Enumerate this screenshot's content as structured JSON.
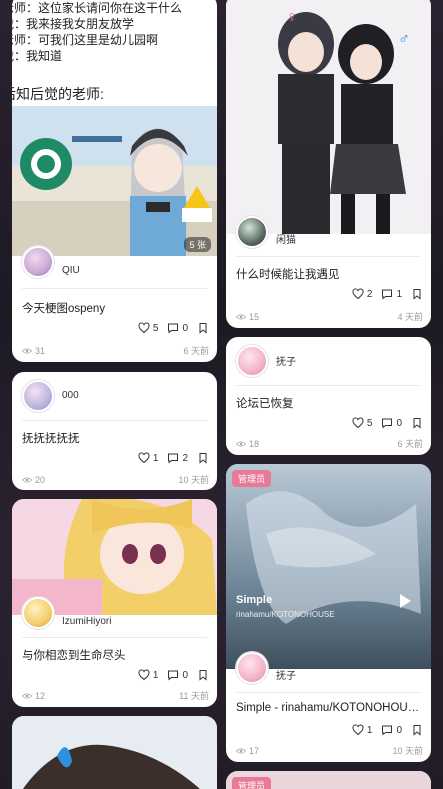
{
  "left_column": {
    "text_post": {
      "lines": [
        "老师：这位家长请问你在这干什么",
        "我：我来接我女朋友放学",
        "老师：可我们这里是幼儿园啊",
        "我：我知道"
      ],
      "heading": "后知后觉的老师:"
    },
    "cards": [
      {
        "author": "QIU",
        "image_count": "5 张",
        "title": "今天梗图ospeny",
        "likes": "5",
        "comments": "0",
        "views": "31",
        "time": "6 天前"
      },
      {
        "author": "000",
        "title": "抚抚抚抚抚",
        "likes": "1",
        "comments": "2",
        "views": "20",
        "time": "10 天前"
      },
      {
        "author": "IzumiHiyori",
        "title": "与你相恋到生命尽头",
        "likes": "1",
        "comments": "0",
        "views": "12",
        "time": "11 天前"
      }
    ]
  },
  "right_column": {
    "cards": [
      {
        "author": "闲猫",
        "title": "什么时候能让我遇见",
        "likes": "2",
        "comments": "1",
        "views": "15",
        "time": "4 天前"
      },
      {
        "author": "抚子",
        "title": "论坛已恢复",
        "likes": "5",
        "comments": "0",
        "views": "18",
        "time": "6 天前"
      },
      {
        "tag": "管理员",
        "music_title": "Simple",
        "music_artist": "rinahamu/KOTONOHOUSE",
        "author": "抚子",
        "title": "Simple - rinahamu/KOTONOHOUSE",
        "likes": "1",
        "comments": "0",
        "views": "17",
        "time": "10 天前"
      },
      {
        "tag": "管理员"
      }
    ]
  },
  "colors": {
    "accent": "#e87a95",
    "card_bg": "#ffffff",
    "meta": "#9a9a9a"
  },
  "icons": [
    "heart-icon",
    "comment-icon",
    "bookmark-icon",
    "eye-icon",
    "play-icon"
  ]
}
